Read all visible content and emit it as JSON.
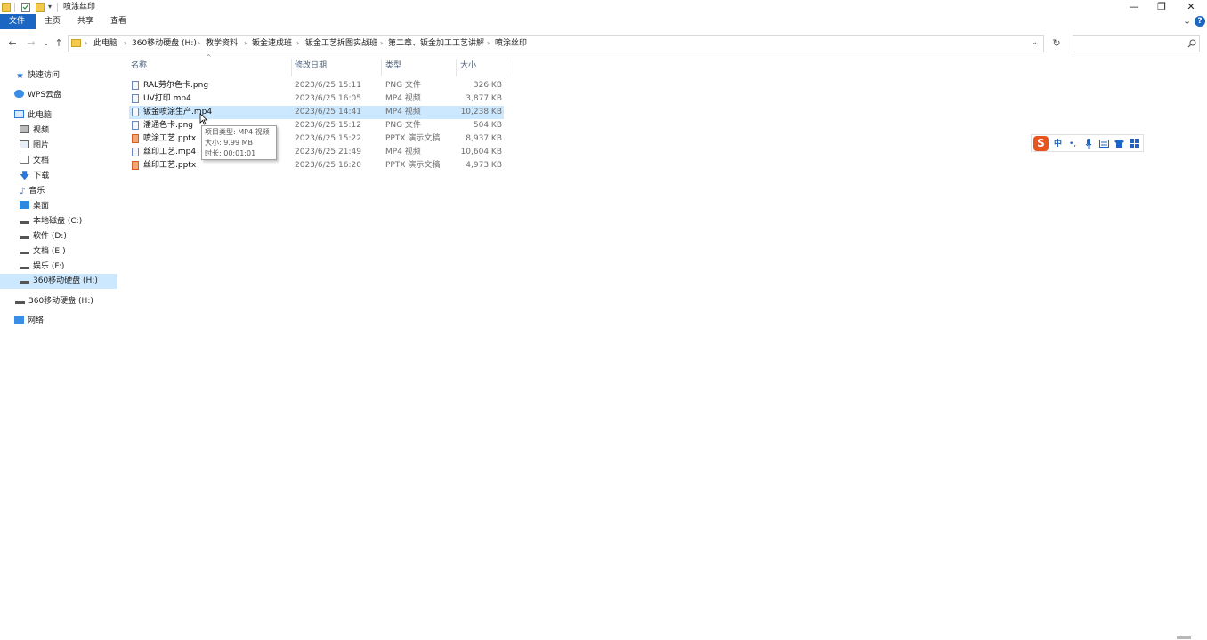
{
  "window": {
    "title": "喷涂丝印",
    "controls": [
      "—",
      "❐",
      "✕"
    ]
  },
  "ribbon": {
    "tabs": [
      "文件",
      "主页",
      "共享",
      "查看"
    ],
    "expand": "⌄",
    "help": "?"
  },
  "address": {
    "crumbs": [
      "此电脑",
      "360移动硬盘 (H:)",
      "教学资料",
      "钣金速成班",
      "钣金工艺拆图实战班",
      "第二章、钣金加工工艺讲解",
      "喷涂丝印"
    ],
    "search_placeholder": ""
  },
  "sidebar": {
    "items": [
      {
        "label": "快速访问",
        "icon": "star-icon"
      },
      {
        "label": "WPS云盘",
        "icon": "cloud-icon"
      },
      {
        "label": "此电脑",
        "icon": "computer-icon"
      },
      {
        "label": "视频",
        "icon": "video-icon"
      },
      {
        "label": "图片",
        "icon": "picture-icon"
      },
      {
        "label": "文档",
        "icon": "document-icon"
      },
      {
        "label": "下载",
        "icon": "download-icon"
      },
      {
        "label": "音乐",
        "icon": "music-icon"
      },
      {
        "label": "桌面",
        "icon": "desktop-icon"
      },
      {
        "label": "本地磁盘 (C:)",
        "icon": "drive-icon"
      },
      {
        "label": "软件 (D:)",
        "icon": "drive-icon"
      },
      {
        "label": "文档 (E:)",
        "icon": "drive-icon"
      },
      {
        "label": "娱乐 (F:)",
        "icon": "drive-icon"
      },
      {
        "label": "360移动硬盘 (H:)",
        "icon": "drive-icon"
      },
      {
        "label": "360移动硬盘 (H:)",
        "icon": "drive-icon"
      },
      {
        "label": "网络",
        "icon": "network-icon"
      }
    ]
  },
  "columns": {
    "name": "名称",
    "date": "修改日期",
    "type": "类型",
    "size": "大小",
    "sort_arrow": "^"
  },
  "files": [
    {
      "name": "RAL劳尔色卡.png",
      "date": "2023/6/25 15:11",
      "type": "PNG 文件",
      "size": "326 KB",
      "kind": "image"
    },
    {
      "name": "UV打印.mp4",
      "date": "2023/6/25 16:05",
      "type": "MP4 视频",
      "size": "3,877 KB",
      "kind": "video"
    },
    {
      "name": "钣金喷涂生产.mp4",
      "date": "2023/6/25 14:41",
      "type": "MP4 视频",
      "size": "10,238 KB",
      "kind": "video"
    },
    {
      "name": "潘通色卡.png",
      "date": "2023/6/25 15:12",
      "type": "PNG 文件",
      "size": "504 KB",
      "kind": "image"
    },
    {
      "name": "喷涂工艺.pptx",
      "date": "2023/6/25 15:22",
      "type": "PPTX 演示文稿",
      "size": "8,937 KB",
      "kind": "ppt"
    },
    {
      "name": "丝印工艺.mp4",
      "date": "2023/6/25 21:49",
      "type": "MP4 视频",
      "size": "10,604 KB",
      "kind": "video"
    },
    {
      "name": "丝印工艺.pptx",
      "date": "2023/6/25 16:20",
      "type": "PPTX 演示文稿",
      "size": "4,973 KB",
      "kind": "ppt"
    }
  ],
  "tooltip": {
    "lines": [
      "项目类型: MP4 视频",
      "大小: 9.99 MB",
      "时长: 00:01:01"
    ]
  },
  "ime": {
    "logo": "S",
    "lang": "中",
    "punct": "•,"
  }
}
